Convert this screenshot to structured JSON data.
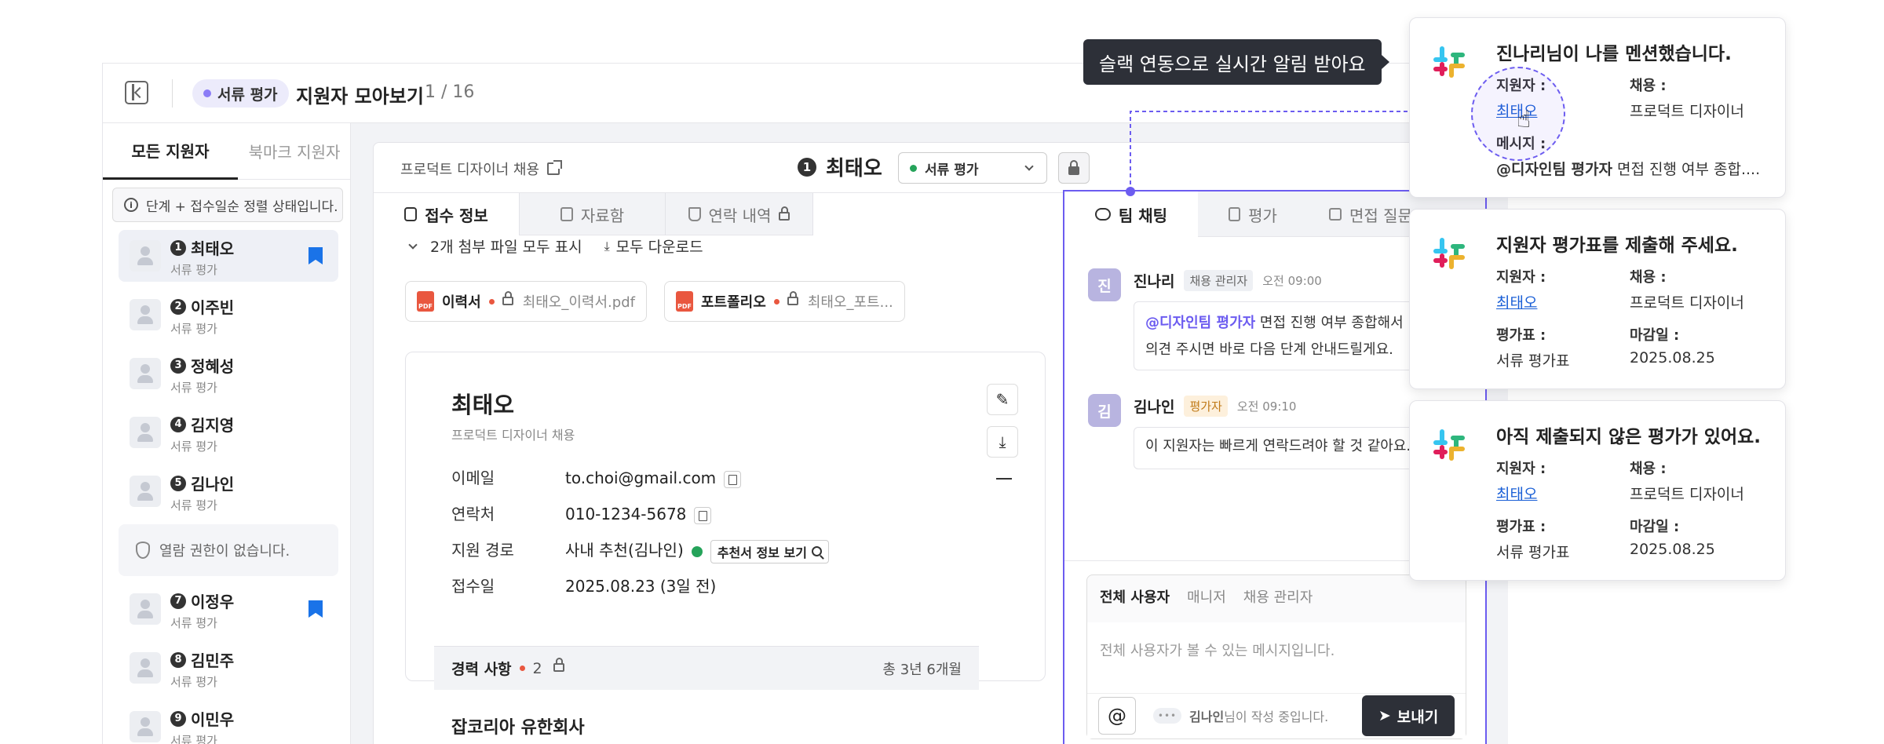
{
  "header": {
    "stage_label": "서류 평가",
    "title": "지원자 모아보기",
    "count": "1 / 16"
  },
  "sidebar": {
    "tab_all": "모든 지원자",
    "tab_bookmark": "북마크 지원자",
    "info": "단계 + 접수일순 정렬 상태입니다.",
    "no_permission": "열람 권한이 없습니다.",
    "candidates": [
      {
        "num": "1",
        "name": "최태오",
        "stage": "서류 평가",
        "bookmarked": true,
        "selected": true
      },
      {
        "num": "2",
        "name": "이주빈",
        "stage": "서류 평가"
      },
      {
        "num": "3",
        "name": "정혜성",
        "stage": "서류 평가"
      },
      {
        "num": "4",
        "name": "김지영",
        "stage": "서류 평가"
      },
      {
        "num": "5",
        "name": "김나인",
        "stage": "서류 평가"
      },
      {
        "num": "7",
        "name": "이정우",
        "stage": "서류 평가",
        "bookmarked": true
      },
      {
        "num": "8",
        "name": "김민주",
        "stage": "서류 평가"
      },
      {
        "num": "9",
        "name": "이민우",
        "stage": "서류 평가"
      }
    ]
  },
  "detail": {
    "job_link": "프로덕트 디자이너 채용",
    "candidate_num": "1",
    "candidate_name": "최태오",
    "stage_select": "서류 평가",
    "tabs": [
      "접수 정보",
      "자료함",
      "연락 내역"
    ],
    "attachments_toggle": "2개 첨부 파일 모두 표시",
    "download_all": "모두 다운로드",
    "files": [
      {
        "label": "이력서",
        "filename": "최태오_이력서.pdf"
      },
      {
        "label": "포트폴리오",
        "filename": "최태오_포트..."
      }
    ],
    "card": {
      "name": "최태오",
      "job": "프로덕트 디자이너 채용",
      "email_label": "이메일",
      "email": "to.choi@gmail.com",
      "phone_label": "연락처",
      "phone": "010-1234-5678",
      "route_label": "지원 경로",
      "route": "사내 추천(김나인)",
      "ref_button": "추천서 정보 보기",
      "date_label": "접수일",
      "date": "2025.08.23 (3일 전)",
      "exp_label": "경력 사항",
      "exp_count": "2",
      "exp_total": "총 3년 6개월",
      "company": "잡코리아 유한회사"
    }
  },
  "chat": {
    "tabs": [
      "팀 채팅",
      "평가",
      "면접 질문"
    ],
    "messages": [
      {
        "avatar": "진",
        "name": "진나리",
        "role": "채용 관리자",
        "time": "오전 09:00",
        "mention": "@디자인팀 평가자",
        "text1": " 면접 진행 여부 종합해서",
        "text2": "의견 주시면 바로 다음 단계 안내드릴게요."
      },
      {
        "avatar": "김",
        "name": "김나인",
        "role": "평가자",
        "time": "오전 09:10",
        "text1": "이 지원자는 빠르게 연락드려야 할 것 같아요."
      }
    ],
    "composer_tabs": [
      "전체 사용자",
      "매니저",
      "채용 관리자"
    ],
    "placeholder": "전체 사용자가 볼 수 있는 메시지입니다.",
    "at": "@",
    "typing_name": "김나인",
    "typing_suffix": "님이 작성 중입니다.",
    "send": "보내기"
  },
  "tooltip": "슬랙 연동으로 실시간 알림 받아요",
  "notifications": [
    {
      "title": "진나리님이 나를 멘션했습니다.",
      "l1": "지원자 :",
      "v1": "최태오",
      "l2": "채용 :",
      "v2": "프로덕트 디자이너",
      "l3": "메시지 :",
      "mention": "@디자인팀 평가자",
      "v3": " 면접 진행 여부 종합...."
    },
    {
      "title": "지원자 평가표를 제출해 주세요.",
      "l1": "지원자 :",
      "v1": "최태오",
      "l2": "채용 :",
      "v2": "프로덕트 디자이너",
      "l3": "평가표 :",
      "v3": "서류 평가표",
      "l4": "마감일 :",
      "v4": "2025.08.25"
    },
    {
      "title": "아직 제출되지 않은 평가가 있어요.",
      "l1": "지원자 :",
      "v1": "최태오",
      "l2": "채용 :",
      "v2": "프로덕트 디자이너",
      "l3": "평가표 :",
      "v3": "서류 평가표",
      "l4": "마감일 :",
      "v4": "2025.08.25"
    }
  ],
  "colors": {
    "accent": "#6c5cf0",
    "bookmark": "#1a73e8",
    "link": "#1a5fd6",
    "slack_red": "#e01e5a",
    "slack_blue": "#36c5f0",
    "slack_green": "#2eb67d",
    "slack_yellow": "#ecb22e"
  }
}
